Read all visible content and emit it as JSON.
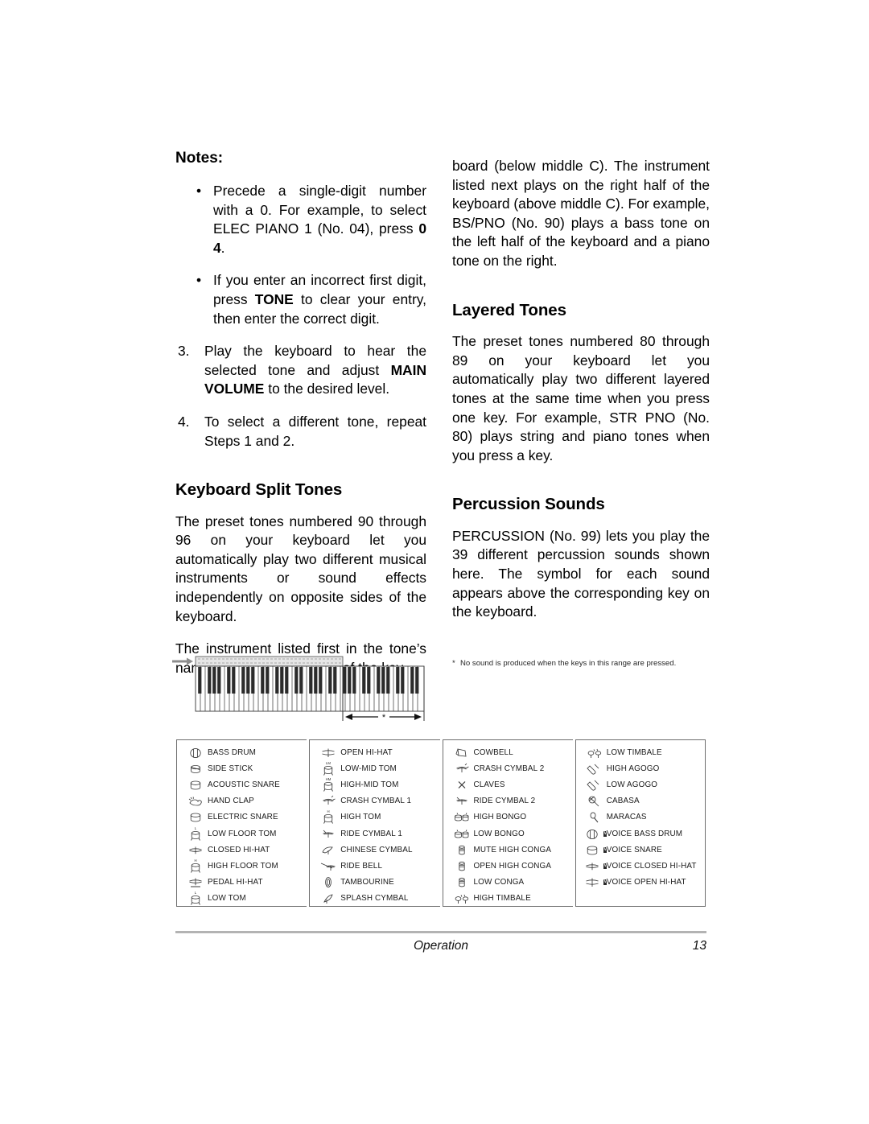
{
  "page": {
    "footer_section": "Operation",
    "page_number": "13"
  },
  "left_column": {
    "notes_heading": "Notes:",
    "bullets": [
      {
        "marker": "•",
        "parts": [
          {
            "text": "Precede a single-digit number with a 0. For example, to select ELEC PIANO 1 (No. 04), press ",
            "bold": false
          },
          {
            "text": "0 4",
            "bold": true
          },
          {
            "text": ".",
            "bold": false
          }
        ]
      },
      {
        "marker": "•",
        "parts": [
          {
            "text": "If you enter an incorrect first digit, press ",
            "bold": false
          },
          {
            "text": "TONE",
            "bold": true
          },
          {
            "text": " to clear your entry, then enter the correct digit.",
            "bold": false
          }
        ]
      }
    ],
    "steps": [
      {
        "number": "3.",
        "parts": [
          {
            "text": "Play the keyboard to hear the selected tone and adjust ",
            "bold": false
          },
          {
            "text": "MAIN VOLUME",
            "bold": true
          },
          {
            "text": " to the desired level.",
            "bold": false
          }
        ]
      },
      {
        "number": "4.",
        "parts": [
          {
            "text": "To select a different tone, repeat Steps 1 and 2.",
            "bold": false
          }
        ]
      }
    ],
    "split_heading": "Keyboard Split Tones",
    "split_paragraph_1": "The preset tones numbered 90 through 96 on your keyboard let you automatically play two different musical instruments or sound effects independently on opposite sides of the keyboard.",
    "split_paragraph_2": "The instrument listed first in the tone’s name plays on the left half of the key-"
  },
  "right_column": {
    "continued_paragraph": "board (below middle C). The instrument listed next plays on the right half of the keyboard (above middle C). For example, BS/PNO (No. 90) plays a bass tone on the left half of the keyboard and a piano tone on the right.",
    "layered_heading": "Layered Tones",
    "layered_paragraph": "The preset tones numbered 80 through 89 on your keyboard let you automatically play two different layered tones at the same time when you press one key. For example, STR PNO (No. 80) plays string and piano tones when you press a key.",
    "percussion_heading": "Percussion Sounds",
    "percussion_paragraph": "PERCUSSION (No. 99) lets you play the 39 different percussion sounds shown here. The symbol for each sound appears above the corresponding key on the keyboard."
  },
  "figure": {
    "footnote_marker": "*",
    "footnote_text": "No sound is produced when the keys in this range are pressed.",
    "range_marker": "*",
    "diagram_name": "keyboard-diagram"
  },
  "percussion_table": {
    "columns": [
      {
        "rows": [
          {
            "icon": "bass-drum-icon",
            "label": "BASS DRUM"
          },
          {
            "icon": "side-stick-icon",
            "label": "SIDE STICK"
          },
          {
            "icon": "acoustic-snare-icon",
            "label": "ACOUSTIC SNARE"
          },
          {
            "icon": "hand-clap-icon",
            "label": "HAND CLAP"
          },
          {
            "icon": "electric-snare-icon",
            "label": "ELECTRIC SNARE"
          },
          {
            "icon": "low-floor-tom-icon",
            "label": "LOW FLOOR TOM"
          },
          {
            "icon": "closed-hi-hat-icon",
            "label": "CLOSED HI-HAT"
          },
          {
            "icon": "high-floor-tom-icon",
            "label": "HIGH FLOOR TOM"
          },
          {
            "icon": "pedal-hi-hat-icon",
            "label": "PEDAL HI-HAT"
          },
          {
            "icon": "low-tom-icon",
            "label": "LOW TOM"
          }
        ]
      },
      {
        "rows": [
          {
            "icon": "open-hi-hat-icon",
            "label": "OPEN HI-HAT"
          },
          {
            "icon": "low-mid-tom-icon",
            "label": "LOW-MID TOM"
          },
          {
            "icon": "high-mid-tom-icon",
            "label": "HIGH-MID TOM"
          },
          {
            "icon": "crash-cymbal-1-icon",
            "label": "CRASH CYMBAL 1"
          },
          {
            "icon": "high-tom-icon",
            "label": "HIGH TOM"
          },
          {
            "icon": "ride-cymbal-1-icon",
            "label": "RIDE CYMBAL 1"
          },
          {
            "icon": "chinese-cymbal-icon",
            "label": "CHINESE CYMBAL"
          },
          {
            "icon": "ride-bell-icon",
            "label": "RIDE BELL"
          },
          {
            "icon": "tambourine-icon",
            "label": "TAMBOURINE"
          },
          {
            "icon": "splash-cymbal-icon",
            "label": "SPLASH CYMBAL"
          }
        ]
      },
      {
        "rows": [
          {
            "icon": "cowbell-icon",
            "label": "COWBELL"
          },
          {
            "icon": "crash-cymbal-2-icon",
            "label": "CRASH CYMBAL 2"
          },
          {
            "icon": "claves-icon",
            "label": "CLAVES"
          },
          {
            "icon": "ride-cymbal-2-icon",
            "label": "RIDE CYMBAL 2"
          },
          {
            "icon": "high-bongo-icon",
            "label": "HIGH BONGO"
          },
          {
            "icon": "low-bongo-icon",
            "label": "LOW BONGO"
          },
          {
            "icon": "mute-high-conga-icon",
            "label": "MUTE HIGH CONGA"
          },
          {
            "icon": "open-high-conga-icon",
            "label": "OPEN HIGH CONGA"
          },
          {
            "icon": "low-conga-icon",
            "label": "LOW CONGA"
          },
          {
            "icon": "high-timbale-icon",
            "label": "HIGH TIMBALE"
          }
        ]
      },
      {
        "rows": [
          {
            "icon": "low-timbale-icon",
            "label": "LOW TIMBALE"
          },
          {
            "icon": "high-agogo-icon",
            "label": "HIGH AGOGO"
          },
          {
            "icon": "low-agogo-icon",
            "label": "LOW AGOGO"
          },
          {
            "icon": "cabasa-icon",
            "label": "CABASA"
          },
          {
            "icon": "maracas-icon",
            "label": "MARACAS"
          },
          {
            "icon": "voice-bass-drum-icon",
            "label": "VOICE BASS DRUM"
          },
          {
            "icon": "voice-snare-icon",
            "label": "VOICE SNARE"
          },
          {
            "icon": "voice-closed-hi-hat-icon",
            "label": "VOICE CLOSED HI-HAT"
          },
          {
            "icon": "voice-open-hi-hat-icon",
            "label": "VOICE OPEN HI-HAT"
          }
        ]
      }
    ],
    "icon_superscripts": {
      "low-floor-tom-icon": "L",
      "high-floor-tom-icon": "H",
      "low-tom-icon": "L",
      "low-mid-tom-icon": "LM",
      "high-mid-tom-icon": "HM",
      "high-tom-icon": "H"
    },
    "voice_badge": "V"
  }
}
